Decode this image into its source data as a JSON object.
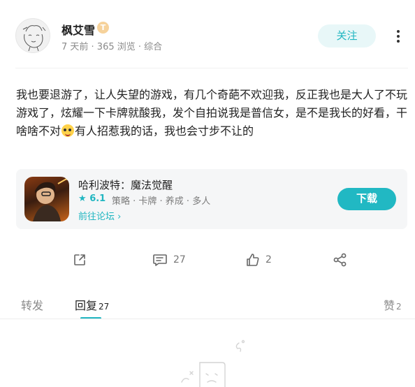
{
  "author": {
    "name": "枫艾雪",
    "level_badge": "T",
    "meta": "7 天前 · 365 浏览 · 综合",
    "follow_label": "关注"
  },
  "post": {
    "text_before_emoji": "我也要退游了，让人失望的游戏，有几个奇葩不欢迎我，反正我也是大人了不玩游戏了，炫耀一下卡牌就酸我，发个自拍说我是普信女，是不是我长的好看，干啥啥不对",
    "text_after_emoji": "有人招惹我的话，我也会寸步不让的"
  },
  "game_card": {
    "title": "哈利波特：魔法觉醒",
    "rating": "6.1",
    "tags": "策略 · 卡牌 · 养成 · 多人",
    "forum_link": "前往论坛",
    "download_label": "下载"
  },
  "actions": {
    "share_icon": "share-out-icon",
    "comment_count": "27",
    "like_count": "2",
    "forward_icon": "share-nodes-icon"
  },
  "tabs": {
    "repost": "转发",
    "replies": "回复",
    "replies_count": "27",
    "likes": "赞",
    "likes_count": "2"
  },
  "colors": {
    "accent": "#21b6c1",
    "card_bg": "#f5f6f7"
  }
}
